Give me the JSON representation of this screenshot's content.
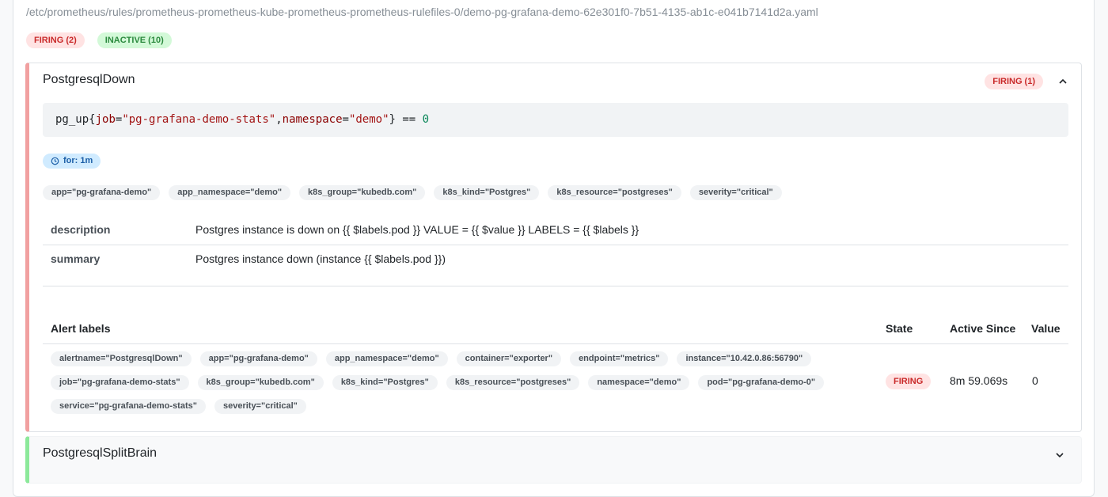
{
  "file": {
    "path": "/etc/prometheus/rules/prometheus-prometheus-kube-prometheus-prometheus-rulefiles-0/demo-pg-grafana-demo-62e301f0-7b51-4135-ab1c-e041b7141d2a.yaml"
  },
  "summary_badges": {
    "firing": "FIRING (2)",
    "inactive": "INACTIVE (10)"
  },
  "rule": {
    "name": "PostgresqlDown",
    "state_badge": "FIRING (1)",
    "expr": {
      "metric": "pg_up",
      "open": "{",
      "l1_key": "job",
      "eq1": "=",
      "l1_val": "\"pg-grafana-demo-stats\"",
      "comma": ",",
      "l2_key": "namespace",
      "eq2": "=",
      "l2_val": "\"demo\"",
      "close": "}",
      "op": " == ",
      "num": "0"
    },
    "for": "for: 1m",
    "labels": [
      "app=\"pg-grafana-demo\"",
      "app_namespace=\"demo\"",
      "k8s_group=\"kubedb.com\"",
      "k8s_kind=\"Postgres\"",
      "k8s_resource=\"postgreses\"",
      "severity=\"critical\""
    ],
    "annotations": [
      {
        "key": "description",
        "value": "Postgres instance is down on {{ $labels.pod }} VALUE = {{ $value }} LABELS = {{ $labels }}"
      },
      {
        "key": "summary",
        "value": "Postgres instance down (instance {{ $labels.pod }})"
      }
    ],
    "alerts_table": {
      "headers": {
        "labels": "Alert labels",
        "state": "State",
        "active_since": "Active Since",
        "value": "Value"
      },
      "row": {
        "labels": [
          "alertname=\"PostgresqlDown\"",
          "app=\"pg-grafana-demo\"",
          "app_namespace=\"demo\"",
          "container=\"exporter\"",
          "endpoint=\"metrics\"",
          "instance=\"10.42.0.86:56790\"",
          "job=\"pg-grafana-demo-stats\"",
          "k8s_group=\"kubedb.com\"",
          "k8s_kind=\"Postgres\"",
          "k8s_resource=\"postgreses\"",
          "namespace=\"demo\"",
          "pod=\"pg-grafana-demo-0\"",
          "service=\"pg-grafana-demo-stats\"",
          "severity=\"critical\""
        ],
        "state": "FIRING",
        "active_since": "8m 59.069s",
        "value": "0"
      }
    }
  },
  "rule2": {
    "name": "PostgresqlSplitBrain"
  },
  "colors": {
    "firing_border": "#f1a0a0",
    "inactive_border": "#8ce99a",
    "firing_badge_bg": "#ffe3e3",
    "firing_badge_text": "#c92a2a",
    "inactive_badge_bg": "#d3f9d8",
    "inactive_badge_text": "#2b8a3e"
  }
}
